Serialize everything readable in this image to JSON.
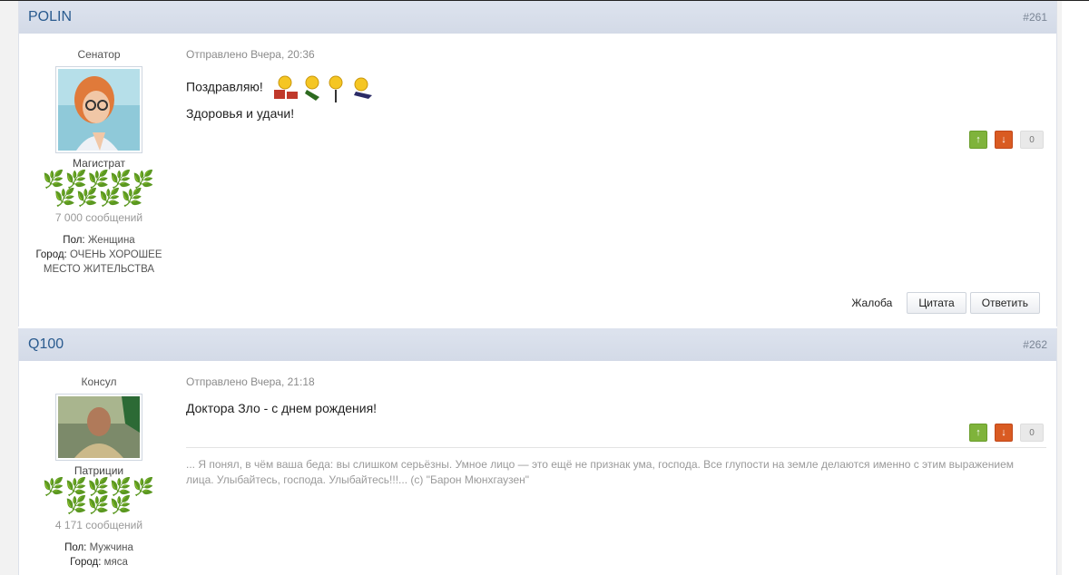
{
  "posts": [
    {
      "author": "POLIN",
      "post_number": "#261",
      "rank_title": "Сенатор",
      "group": "Магистрат",
      "pips": "🌿🌿🌿🌿🌿🌿🌿🌿🌿",
      "post_count": "7 000 сообщений",
      "fields": {
        "gender_label": "Пол:",
        "gender_value": "Женщина",
        "city_label": "Город:",
        "city_value": "ОЧЕНЬ ХОРОШЕЕ МЕСТО ЖИТЕЛЬСТВА"
      },
      "posted": "Отправлено Вчера, 20:36",
      "lines": [
        "Поздравляю!",
        "Здоровья и удачи!"
      ],
      "rep_count": "0",
      "report_label": "Жалоба",
      "quote_label": "Цитата",
      "reply_label": "Ответить"
    },
    {
      "author": "Q100",
      "post_number": "#262",
      "rank_title": "Консул",
      "group": "Патриции",
      "pips": "🌿🌿🌿🌿🌿🌿🌿🌿",
      "post_count": "4 171 сообщений",
      "fields": {
        "gender_label": "Пол:",
        "gender_value": "Мужчина",
        "city_label": "Город:",
        "city_value": "мяса"
      },
      "posted": "Отправлено Вчера, 21:18",
      "lines": [
        "Доктора Зло - с днем рождения!"
      ],
      "rep_count": "0",
      "signature": "... Я понял, в чём ваша беда: вы слишком серьёзны. Умное лицо — это ещё не признак ума, господа. Все глупости на земле делаются именно с этим выражением лица. Улыбайтесь, господа. Улыбайтесь!!!... (с) \"Барон Мюнхгаузен\""
    }
  ],
  "icons": {
    "rep_up": "arrow-up-icon",
    "rep_down": "arrow-down-icon",
    "pip": "laurel-icon",
    "smiley": "smiley-icon"
  },
  "colors": {
    "header_bg": "#d8dfea",
    "author_link": "#2a5b8f",
    "rep_up": "#7fb33b",
    "rep_down": "#d95b22"
  }
}
